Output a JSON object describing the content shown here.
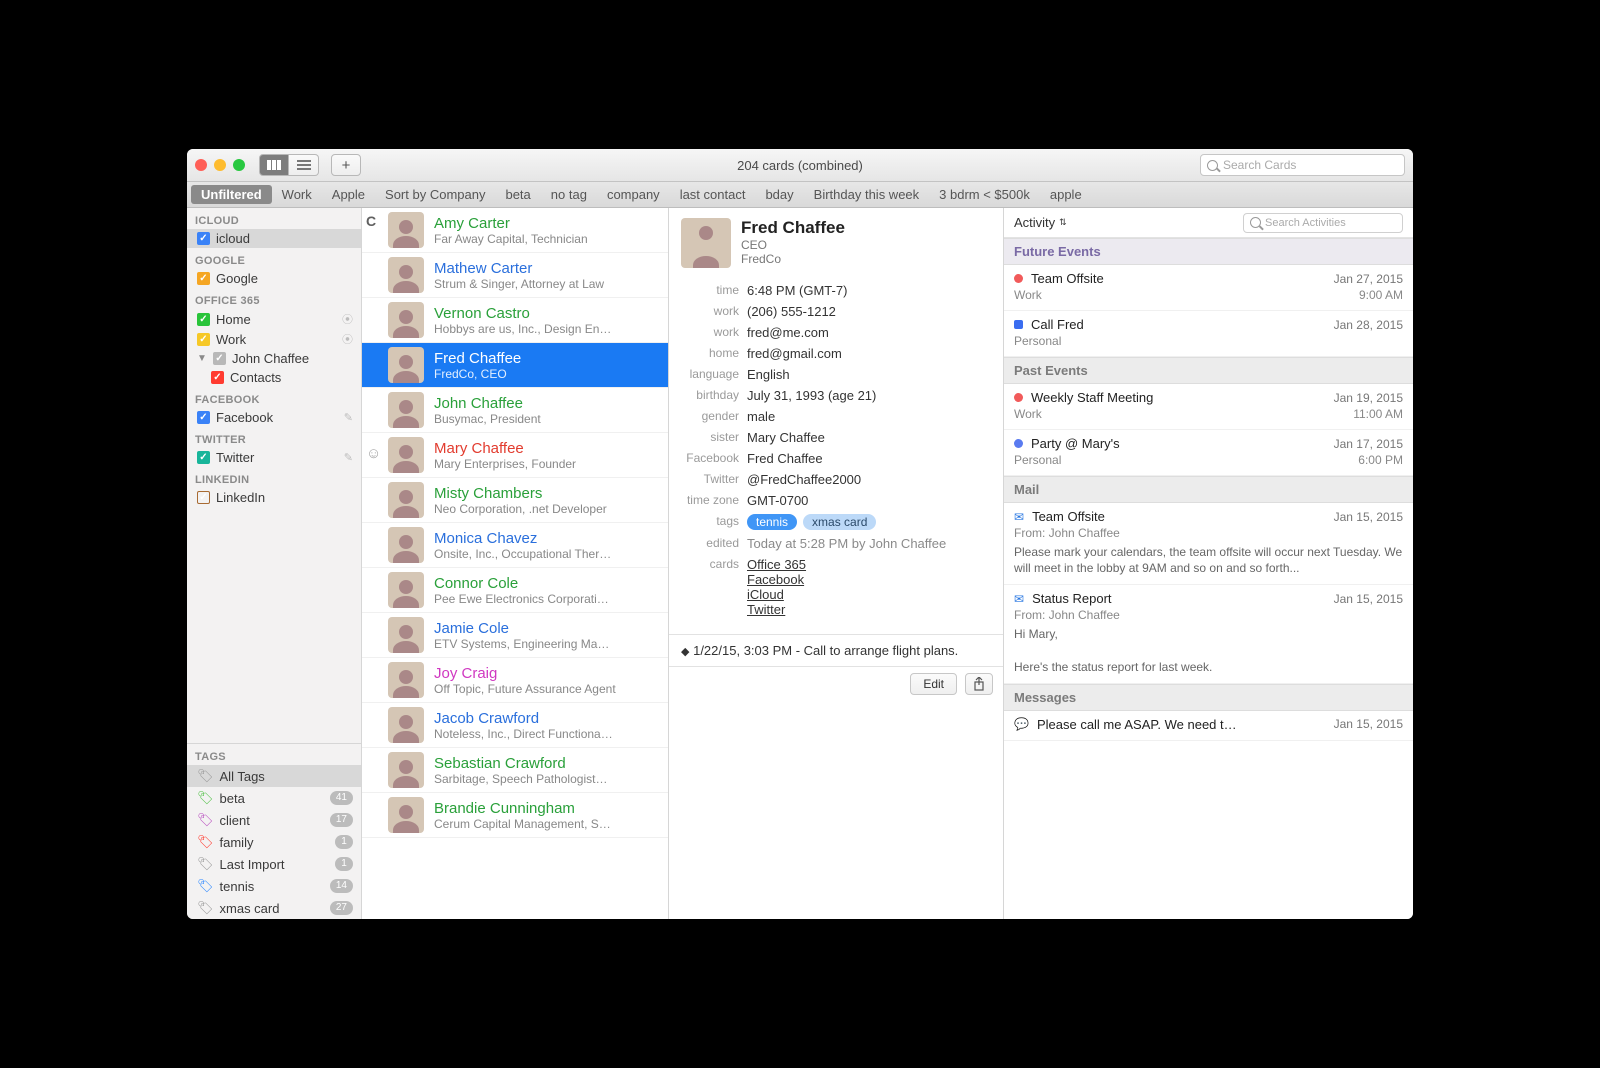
{
  "window": {
    "title": "204 cards (combined)",
    "search_placeholder": "Search Cards"
  },
  "smartbar": [
    "Unfiltered",
    "Work",
    "Apple",
    "Sort by Company",
    "beta",
    "no tag",
    "company",
    "last contact",
    "bday",
    "Birthday this week",
    "3 bdrm < $500k",
    "apple"
  ],
  "sidebar": {
    "groups": [
      {
        "head": "ICLOUD",
        "items": [
          {
            "label": "icloud",
            "color": "#3a82f7",
            "checked": true,
            "selected": true
          }
        ]
      },
      {
        "head": "GOOGLE",
        "items": [
          {
            "label": "Google",
            "color": "#f5a623",
            "checked": true
          }
        ]
      },
      {
        "head": "OFFICE 365",
        "items": [
          {
            "label": "Home",
            "color": "#29c43a",
            "checked": true,
            "rss": true
          },
          {
            "label": "Work",
            "color": "#f6c827",
            "checked": true,
            "rss": true
          },
          {
            "label": "John Chaffee",
            "color": "#b8b8b8",
            "checked": true,
            "disclosure": true
          },
          {
            "label": "Contacts",
            "color": "#ff3b30",
            "checked": true,
            "child": true
          }
        ]
      },
      {
        "head": "FACEBOOK",
        "items": [
          {
            "label": "Facebook",
            "color": "#3a82f7",
            "checked": true,
            "gear": true
          }
        ]
      },
      {
        "head": "TWITTER",
        "items": [
          {
            "label": "Twitter",
            "color": "#18b59a",
            "checked": true,
            "gear": true
          }
        ]
      },
      {
        "head": "LINKEDIN",
        "items": [
          {
            "label": "LinkedIn",
            "color": "#a86b33",
            "checked": false
          }
        ]
      }
    ],
    "tags_head": "TAGS",
    "tags": [
      {
        "label": "All Tags",
        "color": "#9a9a9a",
        "selected": true
      },
      {
        "label": "beta",
        "color": "#54c24a",
        "count": "41"
      },
      {
        "label": "client",
        "color": "#b94fc0",
        "count": "17"
      },
      {
        "label": "family",
        "color": "#ff3b30",
        "count": "1"
      },
      {
        "label": "Last Import",
        "color": "#9a9a9a",
        "count": "1"
      },
      {
        "label": "tennis",
        "color": "#2f89ff",
        "count": "14"
      },
      {
        "label": "xmas card",
        "color": "#9a9a9a",
        "count": "27"
      }
    ]
  },
  "list": {
    "section": "C",
    "items": [
      {
        "name": "Amy Carter",
        "sub": "Far Away Capital, Technician",
        "color": "#2aa03a"
      },
      {
        "name": "Mathew Carter",
        "sub": "Strum & Singer, Attorney at Law",
        "color": "#2a6fdc"
      },
      {
        "name": "Vernon Castro",
        "sub": "Hobbys are us, Inc., Design En…",
        "color": "#2aa03a"
      },
      {
        "name": "Fred Chaffee",
        "sub": "FredCo, CEO",
        "color": "#ffffff",
        "selected": true
      },
      {
        "name": "John Chaffee",
        "sub": "Busymac, President",
        "color": "#2aa03a"
      },
      {
        "name": "Mary Chaffee",
        "sub": "Mary Enterprises, Founder",
        "color": "#e23b2e"
      },
      {
        "name": "Misty Chambers",
        "sub": "Neo Corporation, .net Developer",
        "color": "#2aa03a"
      },
      {
        "name": "Monica Chavez",
        "sub": "Onsite, Inc., Occupational Ther…",
        "color": "#2a6fdc"
      },
      {
        "name": "Connor Cole",
        "sub": "Pee Ewe Electronics Corporati…",
        "color": "#2aa03a"
      },
      {
        "name": "Jamie Cole",
        "sub": "ETV Systems, Engineering Ma…",
        "color": "#2a6fdc"
      },
      {
        "name": "Joy Craig",
        "sub": "Off Topic, Future Assurance Agent",
        "color": "#d038c1"
      },
      {
        "name": "Jacob Crawford",
        "sub": "Noteless, Inc., Direct Functiona…",
        "color": "#2a6fdc"
      },
      {
        "name": "Sebastian Crawford",
        "sub": "Sarbitage, Speech Pathologist…",
        "color": "#2aa03a"
      },
      {
        "name": "Brandie Cunningham",
        "sub": "Cerum Capital Management, S…",
        "color": "#2aa03a"
      }
    ]
  },
  "detail": {
    "name": "Fred Chaffee",
    "role": "CEO",
    "company": "FredCo",
    "fields": [
      {
        "label": "time",
        "value": "6:48 PM (GMT-7)"
      },
      {
        "label": "work",
        "value": "(206) 555-1212"
      },
      {
        "label": "work",
        "value": "fred@me.com"
      },
      {
        "label": "home",
        "value": "fred@gmail.com"
      },
      {
        "label": "language",
        "value": "English"
      },
      {
        "label": "birthday",
        "value": "July 31, 1993 (age 21)"
      },
      {
        "label": "gender",
        "value": "male"
      },
      {
        "label": "sister",
        "value": "Mary Chaffee"
      },
      {
        "label": "Facebook",
        "value": "Fred Chaffee"
      },
      {
        "label": "Twitter",
        "value": "@FredChaffee2000"
      },
      {
        "label": "time zone",
        "value": "GMT-0700"
      }
    ],
    "tags_label": "tags",
    "tags": [
      {
        "label": "tennis",
        "sel": true
      },
      {
        "label": "xmas card"
      }
    ],
    "edited_label": "edited",
    "edited": "Today at 5:28 PM by John Chaffee",
    "cards_label": "cards",
    "cards": [
      "Office 365",
      "Facebook",
      "iCloud",
      "Twitter"
    ],
    "note": "1/22/15, 3:03 PM - Call to arrange flight plans.",
    "edit": "Edit"
  },
  "activity": {
    "title": "Activity",
    "search_placeholder": "Search Activities",
    "sections": [
      {
        "title": "Future Events",
        "kind": "purple",
        "items": [
          {
            "dot": "#f15a5a",
            "shape": "cir",
            "title": "Team Offsite",
            "date": "Jan 27, 2015",
            "sub": "Work",
            "sub_r": "9:00 AM"
          },
          {
            "dot": "#3a6df0",
            "shape": "sq",
            "title": "Call Fred",
            "date": "Jan 28, 2015",
            "sub": "Personal",
            "sub_r": ""
          }
        ]
      },
      {
        "title": "Past Events",
        "kind": "gray",
        "items": [
          {
            "dot": "#f15a5a",
            "shape": "cir",
            "title": "Weekly Staff Meeting",
            "date": "Jan 19, 2015",
            "sub": "Work",
            "sub_r": "11:00 AM"
          },
          {
            "dot": "#5a7bf0",
            "shape": "cir",
            "title": "Party @ Mary's",
            "date": "Jan 17, 2015",
            "sub": "Personal",
            "sub_r": "6:00 PM"
          }
        ]
      },
      {
        "title": "Mail",
        "kind": "gray",
        "items": [
          {
            "mail": true,
            "title": "Team Offsite",
            "date": "Jan 15, 2015",
            "from": "From: John Chaffee",
            "body": "Please mark your calendars, the team offsite will occur next Tuesday. We will meet in the lobby at 9AM and so on and so forth..."
          },
          {
            "mail": true,
            "title": "Status Report",
            "date": "Jan 15, 2015",
            "from": "From: John Chaffee",
            "body": "Hi Mary,\n\nHere's the status report for last week."
          }
        ]
      },
      {
        "title": "Messages",
        "kind": "gray",
        "items": [
          {
            "msg": true,
            "title": "Please call me ASAP. We need t…",
            "date": "Jan 15, 2015"
          }
        ]
      }
    ]
  }
}
